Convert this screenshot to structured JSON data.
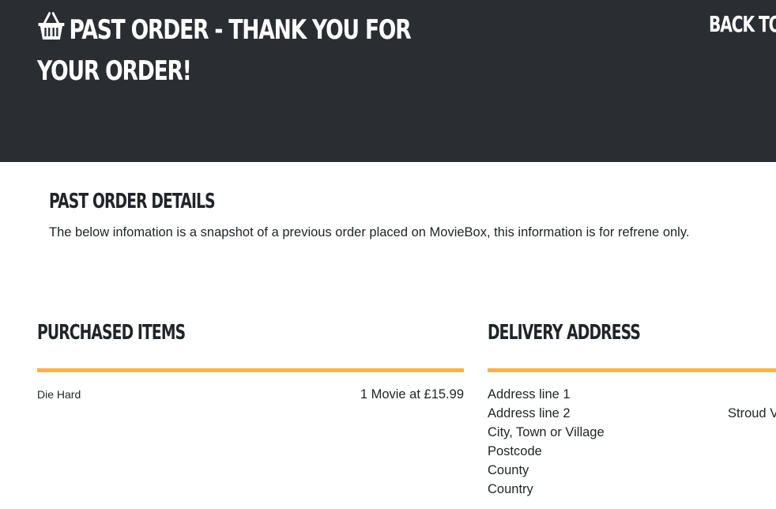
{
  "header": {
    "title": "Past Order - Thank you for your order!",
    "back_label": "Back to"
  },
  "details": {
    "title": "Past Order Details",
    "text": "The below infomation is a snapshot of a previous order placed on MovieBox, this information is for refrene only."
  },
  "purchased": {
    "title": "Purchased Items",
    "items": [
      {
        "name": "Die Hard",
        "quantity": "1 Movie at £15.99"
      }
    ]
  },
  "delivery": {
    "title": "Delivery Address",
    "rows": [
      {
        "label": "Address line 1",
        "value": ""
      },
      {
        "label": "Address line 2",
        "value": "Stroud V"
      },
      {
        "label": "City, Town or Village",
        "value": ""
      },
      {
        "label": "Postcode",
        "value": ""
      },
      {
        "label": "County",
        "value": ""
      },
      {
        "label": "Country",
        "value": ""
      }
    ]
  },
  "colors": {
    "header_bg": "#2a2e33",
    "accent": "#fbb33d"
  },
  "icons": {
    "title_icon": "basket-icon"
  }
}
